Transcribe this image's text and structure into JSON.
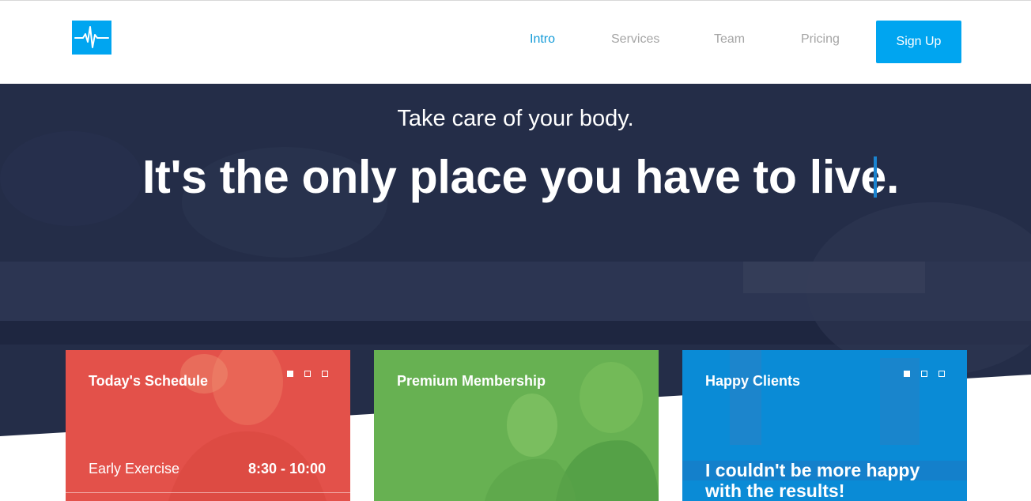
{
  "header": {
    "logo_icon": "heartbeat-icon",
    "nav": [
      {
        "label": "Intro",
        "active": true
      },
      {
        "label": "Services",
        "active": false
      },
      {
        "label": "Team",
        "active": false
      },
      {
        "label": "Pricing",
        "active": false
      }
    ],
    "signup_label": "Sign Up"
  },
  "hero": {
    "subtitle": "Take care of your body.",
    "title": "It's the only place you have to live."
  },
  "cards": {
    "schedule": {
      "title": "Today's Schedule",
      "item_name": "Early Exercise",
      "item_time": "8:30 - 10:00"
    },
    "membership": {
      "title": "Premium Membership"
    },
    "clients": {
      "title": "Happy Clients",
      "quote": "I couldn't be more happy with the results!"
    }
  },
  "colors": {
    "accent": "#00a5f0",
    "active_nav": "#149bd8",
    "hero_bg": "#242d48",
    "card_red": "#e3514a",
    "card_green": "#67b152",
    "card_blue": "#0a8bd6"
  }
}
